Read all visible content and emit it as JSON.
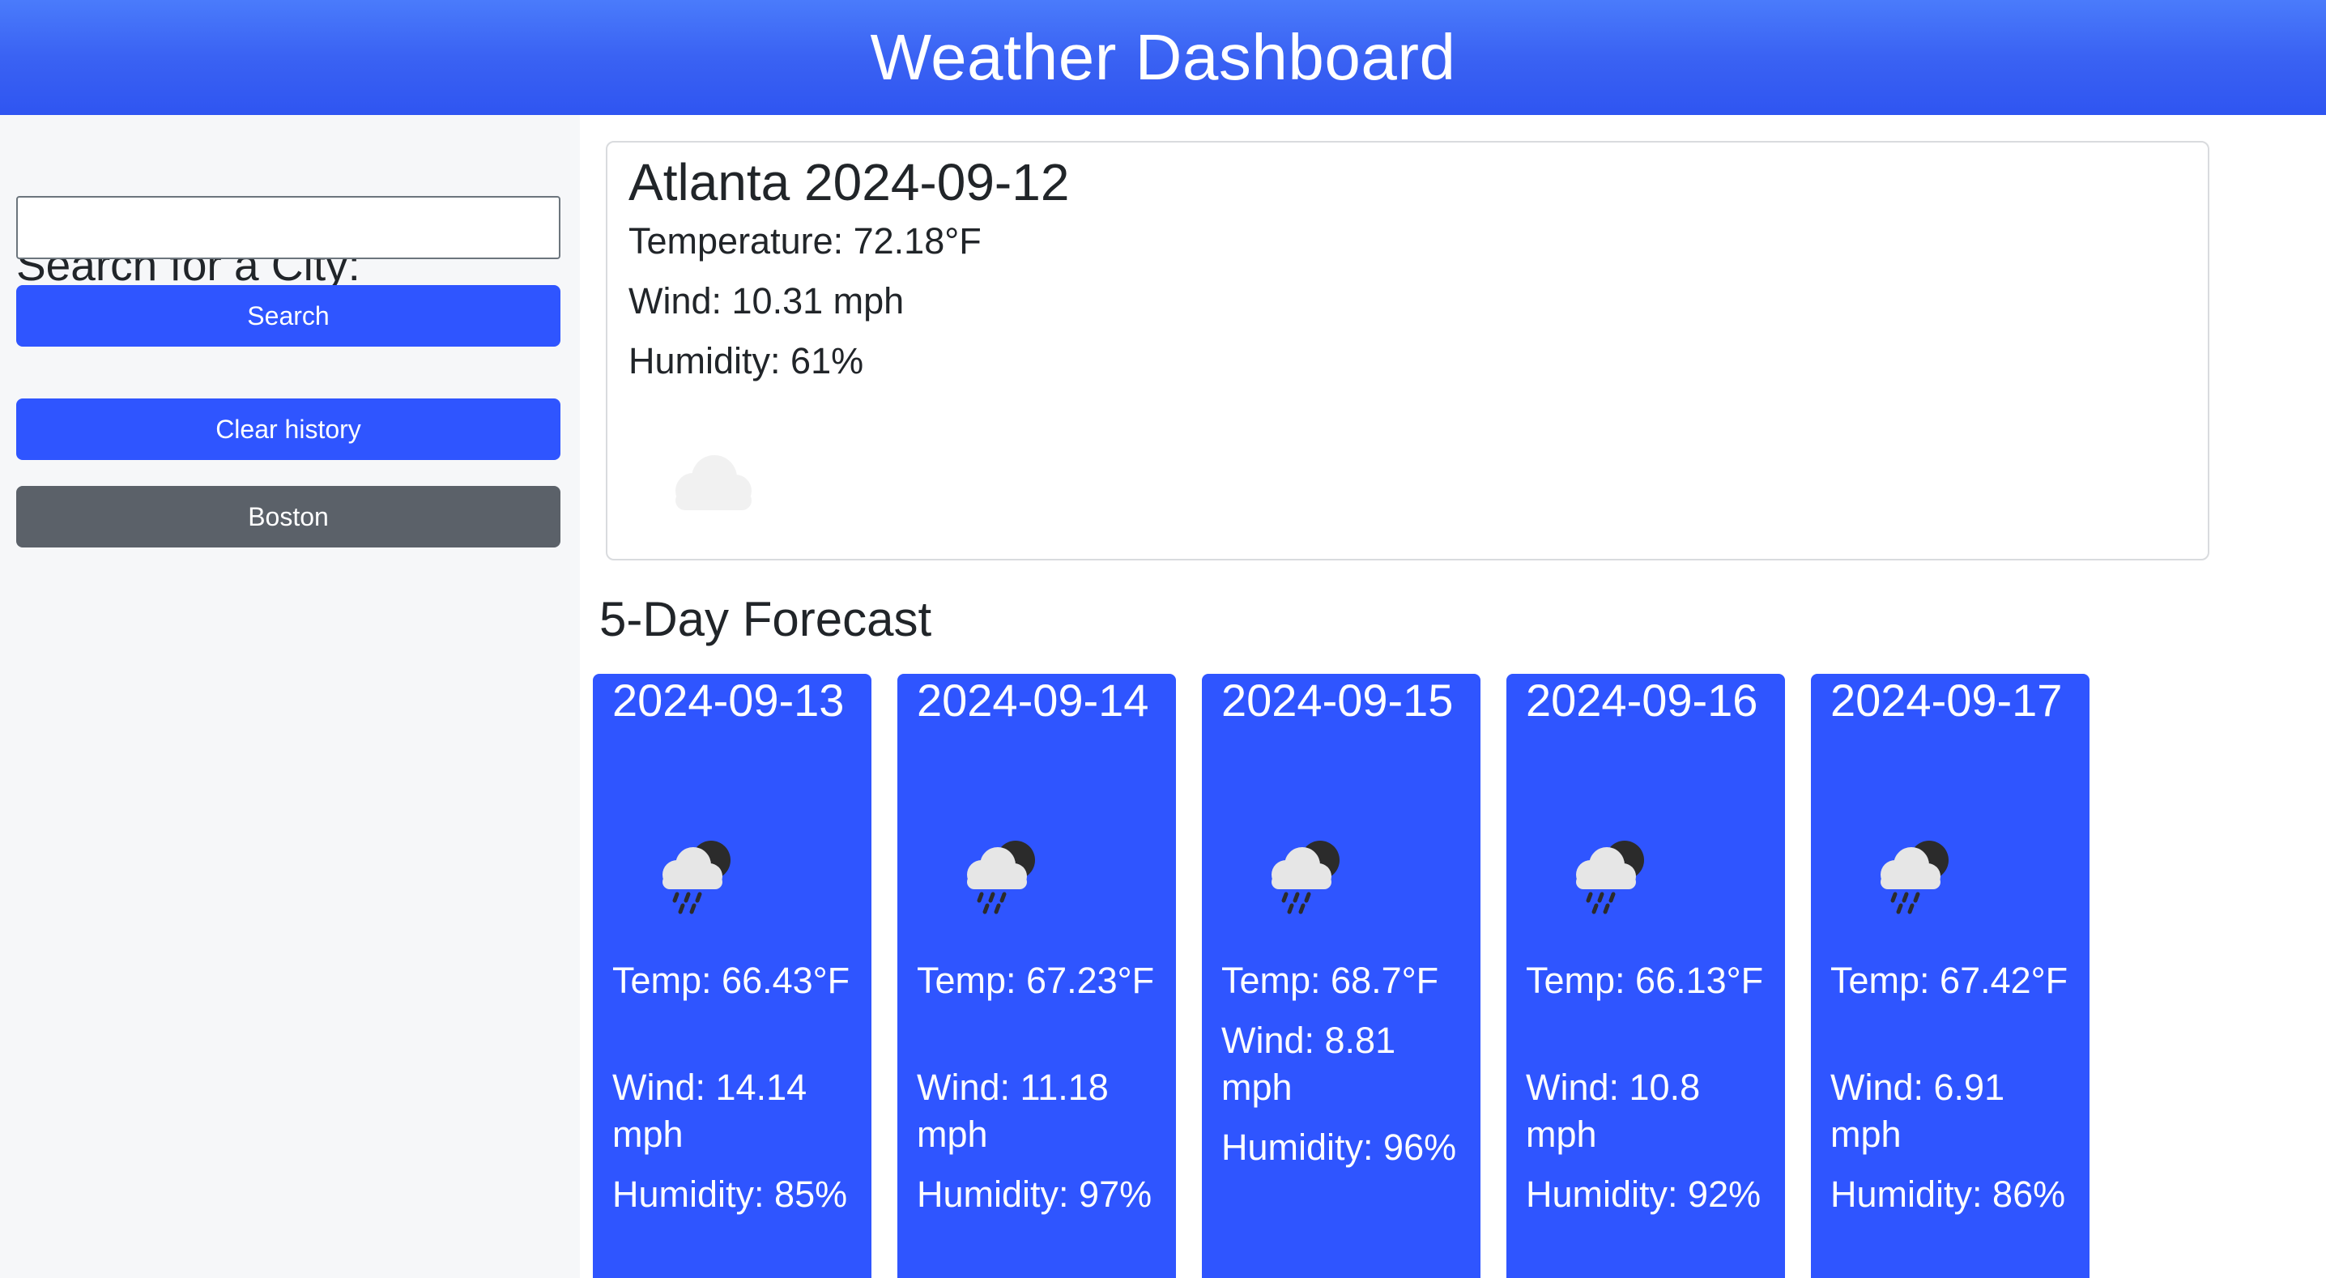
{
  "header": {
    "title": "Weather Dashboard"
  },
  "sidebar": {
    "heading": "Search for a City:",
    "search_placeholder": "",
    "search_value": "",
    "search_button": "Search",
    "clear_button": "Clear history",
    "history": [
      "Boston"
    ]
  },
  "current": {
    "title": "Atlanta 2024-09-12",
    "temperature": "Temperature: 72.18°F",
    "wind": "Wind: 10.31 mph",
    "humidity": "Humidity: 61%",
    "icon": "cloud-icon"
  },
  "forecast": {
    "heading": "5-Day Forecast",
    "days": [
      {
        "date": "2024-09-13",
        "icon": "rain-night-icon",
        "temp": "Temp: 66.43°F",
        "wind": "Wind: 14.14 mph",
        "humidity": "Humidity: 85%"
      },
      {
        "date": "2024-09-14",
        "icon": "rain-night-icon",
        "temp": "Temp: 67.23°F",
        "wind": "Wind: 11.18 mph",
        "humidity": "Humidity: 97%"
      },
      {
        "date": "2024-09-15",
        "icon": "rain-night-icon",
        "temp": "Temp: 68.7°F",
        "wind": "Wind: 8.81 mph",
        "humidity": "Humidity: 96%"
      },
      {
        "date": "2024-09-16",
        "icon": "rain-night-icon",
        "temp": "Temp: 66.13°F",
        "wind": "Wind: 10.8 mph",
        "humidity": "Humidity: 92%"
      },
      {
        "date": "2024-09-17",
        "icon": "rain-night-icon",
        "temp": "Temp: 67.42°F",
        "wind": "Wind: 6.91 mph",
        "humidity": "Humidity: 86%"
      }
    ]
  },
  "colors": {
    "primary": "#2f55ff",
    "secondary": "#5b6169",
    "header": "#3a62f3",
    "sidebar_bg": "#f6f7f9"
  }
}
